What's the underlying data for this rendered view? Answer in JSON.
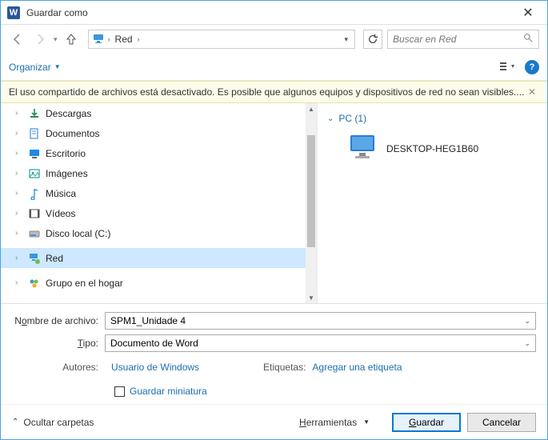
{
  "title": "Guardar como",
  "nav": {
    "path_root": "Red"
  },
  "search": {
    "placeholder": "Buscar en Red"
  },
  "toolbar": {
    "organize": "Organizar"
  },
  "warning": "El uso compartido de archivos está desactivado. Es posible que algunos equipos y dispositivos de red no sean visibles....",
  "tree": [
    {
      "label": "Descargas",
      "icon": "download"
    },
    {
      "label": "Documentos",
      "icon": "doc"
    },
    {
      "label": "Escritorio",
      "icon": "desktop"
    },
    {
      "label": "Imágenes",
      "icon": "images"
    },
    {
      "label": "Música",
      "icon": "music"
    },
    {
      "label": "Vídeos",
      "icon": "video"
    },
    {
      "label": "Disco local (C:)",
      "icon": "disk"
    },
    {
      "label": "Red",
      "icon": "network",
      "selected": true
    },
    {
      "label": "Grupo en el hogar",
      "icon": "homegroup"
    }
  ],
  "content": {
    "group_label": "PC (1)",
    "pc_name": "DESKTOP-HEG1B60"
  },
  "form": {
    "filename_label_pre": "N",
    "filename_label_ul": "o",
    "filename_label_post": "mbre de archivo:",
    "filename_value": "SPM1_Unidade 4",
    "type_label_pre": "",
    "type_label_ul": "T",
    "type_label_post": "ipo:",
    "type_value": "Documento de Word",
    "authors_label": "Autores:",
    "authors_value": "Usuario de Windows",
    "tags_label": "Etiquetas:",
    "tags_value": "Agregar una etiqueta",
    "thumb_label": "Guardar miniatura"
  },
  "footer": {
    "hide_folders": "Ocultar carpetas",
    "tools_pre": "",
    "tools_ul": "H",
    "tools_post": "erramientas",
    "save_ul": "G",
    "save_post": "uardar",
    "cancel": "Cancelar"
  }
}
